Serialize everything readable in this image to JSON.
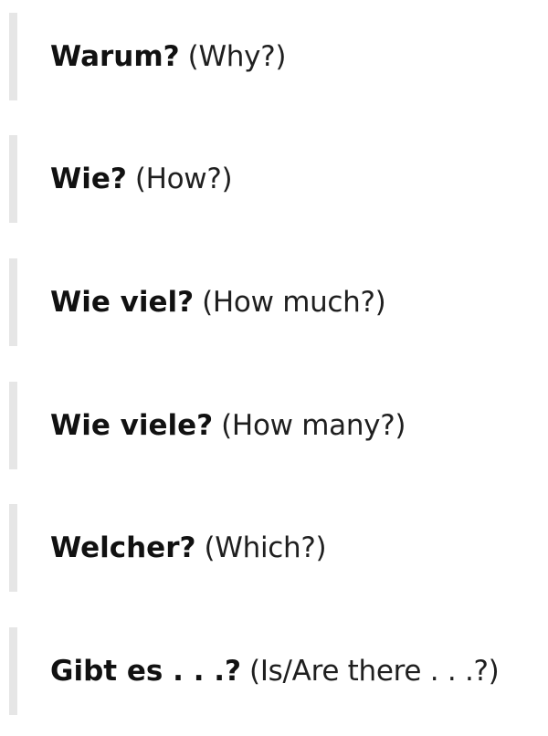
{
  "items": [
    {
      "term": "Warum?",
      "gloss": "(Why?)"
    },
    {
      "term": "Wie?",
      "gloss": "(How?)"
    },
    {
      "term": "Wie viel?",
      "gloss": "(How much?)"
    },
    {
      "term": "Wie viele?",
      "gloss": "(How many?)"
    },
    {
      "term": "Welcher?",
      "gloss": "(Which?)"
    },
    {
      "term": "Gibt es . . .?",
      "gloss": "(Is/Are there . . .?)"
    }
  ],
  "colors": {
    "border": "#e6e6e6",
    "text": "#111111"
  }
}
